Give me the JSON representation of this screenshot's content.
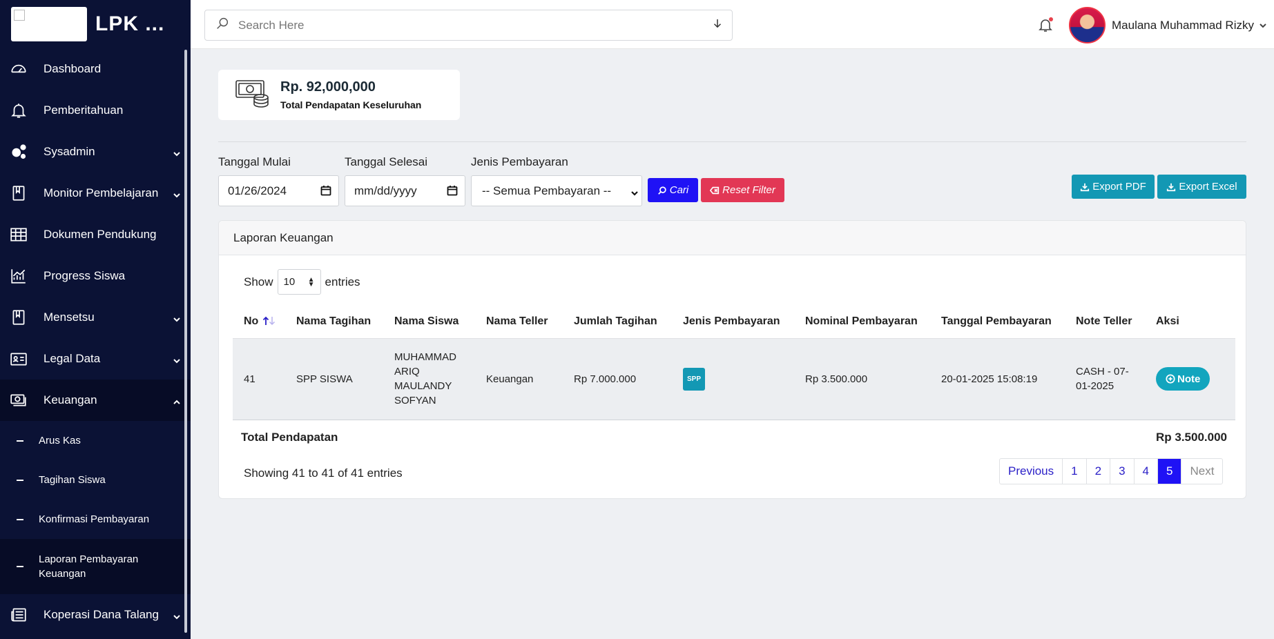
{
  "brand": {
    "name": "LPK ..."
  },
  "sidebar": {
    "items": [
      {
        "label": "Dashboard",
        "icon": "gauge-icon",
        "has_children": false
      },
      {
        "label": "Pemberitahuan",
        "icon": "bell-icon",
        "has_children": false
      },
      {
        "label": "Sysadmin",
        "icon": "gears-icon",
        "has_children": true
      },
      {
        "label": "Monitor Pembelajaran",
        "icon": "book-icon",
        "has_children": true
      },
      {
        "label": "Dokumen Pendukung",
        "icon": "table-icon",
        "has_children": false
      },
      {
        "label": "Progress Siswa",
        "icon": "chart-icon",
        "has_children": false
      },
      {
        "label": "Mensetsu",
        "icon": "book-icon",
        "has_children": true
      },
      {
        "label": "Legal Data",
        "icon": "id-card-icon",
        "has_children": true
      },
      {
        "label": "Keuangan",
        "icon": "money-icon",
        "has_children": true,
        "expanded": true
      },
      {
        "label": "Koperasi Dana Talang",
        "icon": "newspaper-icon",
        "has_children": true
      }
    ],
    "keuangan_sub": [
      {
        "label": "Arus Kas"
      },
      {
        "label": "Tagihan Siswa"
      },
      {
        "label": "Konfirmasi Pembayaran"
      },
      {
        "label": "Laporan Pembayaran Keuangan",
        "active": true
      }
    ]
  },
  "topbar": {
    "search_placeholder": "Search Here",
    "user_name": "Maulana Muhammad Rizky"
  },
  "summary": {
    "value": "Rp. 92,000,000",
    "label": "Total Pendapatan Keseluruhan"
  },
  "filters": {
    "start_label": "Tanggal Mulai",
    "start_value": "01/26/2024",
    "end_label": "Tanggal Selesai",
    "end_value": "mm/dd/yyyy",
    "type_label": "Jenis Pembayaran",
    "type_value": "-- Semua Pembayaran --",
    "search_btn": "Cari",
    "reset_btn": "Reset Filter",
    "export_pdf": "Export PDF",
    "export_excel": "Export Excel"
  },
  "report": {
    "title": "Laporan Keuangan",
    "show_label": "Show",
    "page_size": "10",
    "entries_label": "entries",
    "columns": [
      "No",
      "Nama Tagihan",
      "Nama Siswa",
      "Nama Teller",
      "Jumlah Tagihan",
      "Jenis Pembayaran",
      "Nominal Pembayaran",
      "Tanggal Pembayaran",
      "Note Teller",
      "Aksi"
    ],
    "rows": [
      {
        "no": "41",
        "nama_tagihan": "SPP SISWA",
        "nama_siswa": "MUHAMMAD ARIQ MAULANDY SOFYAN",
        "nama_teller": "Keuangan",
        "jumlah_tagihan": "Rp 7.000.000",
        "jenis_pembayaran": "SPP",
        "nominal_pembayaran": "Rp 3.500.000",
        "tanggal_pembayaran": "20-01-2025 15:08:19",
        "note_teller": "CASH - 07-01-2025",
        "aksi": "Note"
      }
    ],
    "total_label": "Total Pendapatan",
    "total_value": "Rp 3.500.000",
    "info": "Showing 41 to 41 of 41 entries",
    "pagination": {
      "previous": "Previous",
      "pages": [
        "1",
        "2",
        "3",
        "4",
        "5"
      ],
      "active": "5",
      "next": "Next"
    }
  }
}
